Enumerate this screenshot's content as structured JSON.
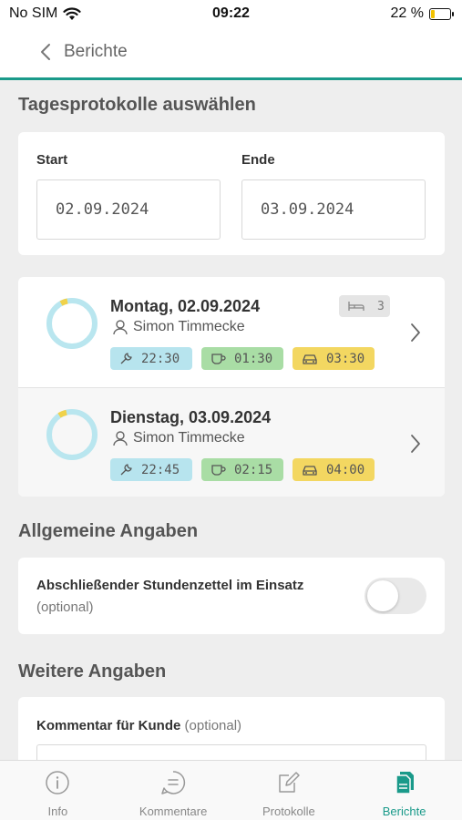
{
  "status_bar": {
    "carrier": "No SIM",
    "time": "09:22",
    "battery": "22 %",
    "battery_level": 0.22
  },
  "nav": {
    "back_label": "Berichte"
  },
  "select_section": {
    "title": "Tagesprotokolle auswählen",
    "start_label": "Start",
    "start_value": "02.09.2024",
    "end_label": "Ende",
    "end_value": "03.09.2024"
  },
  "protocols": [
    {
      "day": "Montag, 02.09.2024",
      "person": "Simon Timmecke",
      "work": "22:30",
      "pause": "01:30",
      "drive": "03:30",
      "nights": "3"
    },
    {
      "day": "Dienstag, 03.09.2024",
      "person": "Simon Timmecke",
      "work": "22:45",
      "pause": "02:15",
      "drive": "04:00"
    }
  ],
  "general": {
    "title": "Allgemeine Angaben",
    "toggle_label": "Abschließender Stundenzettel im Einsatz",
    "toggle_optional": "(optional)"
  },
  "further": {
    "title": "Weitere Angaben",
    "comment_label": "Kommentar für Kunde",
    "comment_optional": "(optional)"
  },
  "tabs": [
    {
      "label": "Info",
      "icon": "info-icon"
    },
    {
      "label": "Kommentare",
      "icon": "comment-icon"
    },
    {
      "label": "Protokolle",
      "icon": "edit-icon"
    },
    {
      "label": "Berichte",
      "icon": "report-icon",
      "active": true
    }
  ],
  "colors": {
    "accent": "#1a9a8a",
    "work": "#b7e4ee",
    "pause": "#a9dda5",
    "drive": "#f3d761"
  }
}
